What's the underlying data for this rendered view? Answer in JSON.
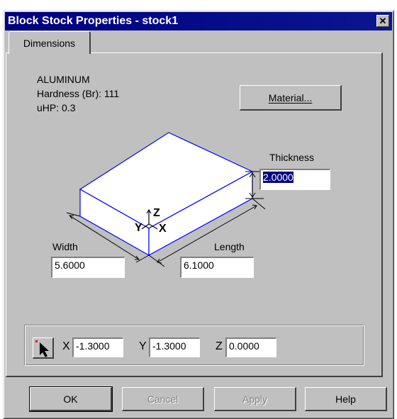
{
  "window": {
    "title": "Block Stock Properties - stock1",
    "close_glyph": "✕"
  },
  "tabs": [
    {
      "label": "Dimensions"
    }
  ],
  "material": {
    "name": "ALUMINUM",
    "hardness": "Hardness (Br):  111",
    "uhp": "uHP: 0.3",
    "button_label": "Material..."
  },
  "dimensions": {
    "thickness_label": "Thickness",
    "thickness_value": "2.0000",
    "width_label": "Width",
    "width_value": "5.6000",
    "length_label": "Length",
    "length_value": "6.1000"
  },
  "axes": {
    "x": "X",
    "y": "Y",
    "z": "Z"
  },
  "origin": {
    "x_label": "X",
    "x_value": "-1.3000",
    "y_label": "Y",
    "y_value": "-1.3000",
    "z_label": "Z",
    "z_value": "0.0000",
    "pick_icon": "arrow-pointer-icon"
  },
  "buttons": {
    "ok": "OK",
    "cancel": "Cancel",
    "apply": "Apply",
    "help": "Help"
  },
  "colors": {
    "title_bar": "#000080",
    "face": "#c0c0c0",
    "block_edges": "#0000ff"
  }
}
